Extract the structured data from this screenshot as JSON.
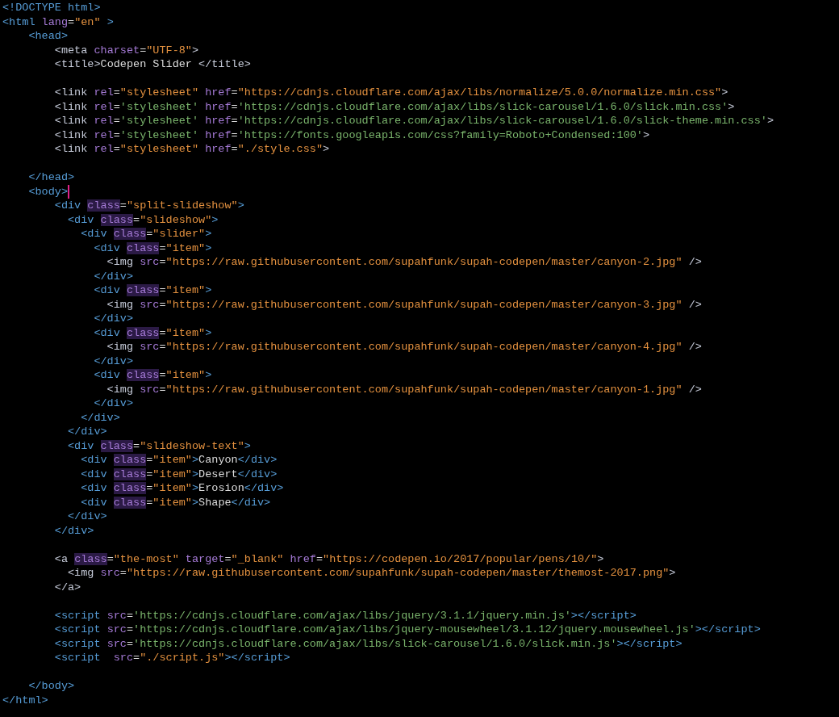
{
  "editor": {
    "lines": [
      {
        "kind": "code",
        "tokens": [
          {
            "kind": "tag",
            "text": "<!DOCTYPE html>"
          }
        ]
      },
      {
        "kind": "code",
        "tokens": [
          {
            "kind": "tag",
            "text": "<html"
          },
          {
            "kind": "attr",
            "text": " lang"
          },
          {
            "kind": "plain",
            "text": "="
          },
          {
            "kind": "string",
            "text": "\"en\""
          },
          {
            "kind": "tag",
            "text": " >"
          }
        ]
      },
      {
        "kind": "code",
        "tokens": [
          {
            "kind": "tag",
            "text": "    <head>"
          }
        ]
      },
      {
        "kind": "code",
        "tokens": [
          {
            "kind": "tag2",
            "text": "        <meta"
          },
          {
            "kind": "attr",
            "text": " charset"
          },
          {
            "kind": "plain",
            "text": "="
          },
          {
            "kind": "string",
            "text": "\"UTF-8\""
          },
          {
            "kind": "tag2",
            "text": ">"
          }
        ]
      },
      {
        "kind": "code",
        "tokens": [
          {
            "kind": "tag2",
            "text": "        <title>"
          },
          {
            "kind": "plain",
            "text": "Codepen Slider "
          },
          {
            "kind": "tag2",
            "text": "</title>"
          }
        ]
      },
      {
        "kind": "blank"
      },
      {
        "kind": "code",
        "tokens": [
          {
            "kind": "tag2",
            "text": "        <link"
          },
          {
            "kind": "attr",
            "text": " rel"
          },
          {
            "kind": "plain",
            "text": "="
          },
          {
            "kind": "string",
            "text": "\"stylesheet\""
          },
          {
            "kind": "attr",
            "text": " href"
          },
          {
            "kind": "plain",
            "text": "="
          },
          {
            "kind": "string",
            "text": "\"https://cdnjs.cloudflare.com/ajax/libs/normalize/5.0.0/normalize.min.css\""
          },
          {
            "kind": "tag2",
            "text": ">"
          }
        ]
      },
      {
        "kind": "code",
        "tokens": [
          {
            "kind": "tag2",
            "text": "        <link"
          },
          {
            "kind": "attr",
            "text": " rel"
          },
          {
            "kind": "plain",
            "text": "="
          },
          {
            "kind": "string-alt",
            "text": "'stylesheet'"
          },
          {
            "kind": "attr",
            "text": " href"
          },
          {
            "kind": "plain",
            "text": "="
          },
          {
            "kind": "string-alt",
            "text": "'https://cdnjs.cloudflare.com/ajax/libs/slick-carousel/1.6.0/slick.min.css'"
          },
          {
            "kind": "tag2",
            "text": ">"
          }
        ]
      },
      {
        "kind": "code",
        "tokens": [
          {
            "kind": "tag2",
            "text": "        <link"
          },
          {
            "kind": "attr",
            "text": " rel"
          },
          {
            "kind": "plain",
            "text": "="
          },
          {
            "kind": "string-alt",
            "text": "'stylesheet'"
          },
          {
            "kind": "attr",
            "text": " href"
          },
          {
            "kind": "plain",
            "text": "="
          },
          {
            "kind": "string-alt",
            "text": "'https://cdnjs.cloudflare.com/ajax/libs/slick-carousel/1.6.0/slick-theme.min.css'"
          },
          {
            "kind": "tag2",
            "text": ">"
          }
        ]
      },
      {
        "kind": "code",
        "tokens": [
          {
            "kind": "tag2",
            "text": "        <link"
          },
          {
            "kind": "attr",
            "text": " rel"
          },
          {
            "kind": "plain",
            "text": "="
          },
          {
            "kind": "string-alt",
            "text": "'stylesheet'"
          },
          {
            "kind": "attr",
            "text": " href"
          },
          {
            "kind": "plain",
            "text": "="
          },
          {
            "kind": "string-alt",
            "text": "'https://fonts.googleapis.com/css?family=Roboto+Condensed:100'"
          },
          {
            "kind": "tag2",
            "text": ">"
          }
        ]
      },
      {
        "kind": "code",
        "tokens": [
          {
            "kind": "tag2",
            "text": "        <link"
          },
          {
            "kind": "attr",
            "text": " rel"
          },
          {
            "kind": "plain",
            "text": "="
          },
          {
            "kind": "string",
            "text": "\"stylesheet\""
          },
          {
            "kind": "attr",
            "text": " href"
          },
          {
            "kind": "plain",
            "text": "="
          },
          {
            "kind": "string",
            "text": "\"./style.css\""
          },
          {
            "kind": "tag2",
            "text": ">"
          }
        ]
      },
      {
        "kind": "blank"
      },
      {
        "kind": "code",
        "tokens": [
          {
            "kind": "tag",
            "text": "    </head>"
          }
        ]
      },
      {
        "kind": "code",
        "tokens": [
          {
            "kind": "tag",
            "text": "    <body>"
          },
          {
            "kind": "cursor"
          }
        ]
      },
      {
        "kind": "code",
        "tokens": [
          {
            "kind": "tag",
            "text": "        <div "
          },
          {
            "kind": "attr-hl",
            "text": "class"
          },
          {
            "kind": "plain",
            "text": "="
          },
          {
            "kind": "string",
            "text": "\"split-slideshow\""
          },
          {
            "kind": "tag",
            "text": ">"
          }
        ]
      },
      {
        "kind": "code",
        "tokens": [
          {
            "kind": "tag",
            "text": "          <div "
          },
          {
            "kind": "attr-hl",
            "text": "class"
          },
          {
            "kind": "plain",
            "text": "="
          },
          {
            "kind": "string",
            "text": "\"slideshow\""
          },
          {
            "kind": "tag",
            "text": ">"
          }
        ]
      },
      {
        "kind": "code",
        "tokens": [
          {
            "kind": "tag",
            "text": "            <div "
          },
          {
            "kind": "attr-hl",
            "text": "class"
          },
          {
            "kind": "plain",
            "text": "="
          },
          {
            "kind": "string",
            "text": "\"slider\""
          },
          {
            "kind": "tag",
            "text": ">"
          }
        ]
      },
      {
        "kind": "code",
        "tokens": [
          {
            "kind": "tag",
            "text": "              <div "
          },
          {
            "kind": "attr-hl",
            "text": "class"
          },
          {
            "kind": "plain",
            "text": "="
          },
          {
            "kind": "string",
            "text": "\"item\""
          },
          {
            "kind": "tag",
            "text": ">"
          }
        ]
      },
      {
        "kind": "code",
        "tokens": [
          {
            "kind": "tag2",
            "text": "                <img"
          },
          {
            "kind": "attr",
            "text": " src"
          },
          {
            "kind": "plain",
            "text": "="
          },
          {
            "kind": "string",
            "text": "\"https://raw.githubusercontent.com/supahfunk/supah-codepen/master/canyon-2.jpg\""
          },
          {
            "kind": "tag2",
            "text": " />"
          }
        ]
      },
      {
        "kind": "code",
        "tokens": [
          {
            "kind": "tag",
            "text": "              </div>"
          }
        ]
      },
      {
        "kind": "code",
        "tokens": [
          {
            "kind": "tag",
            "text": "              <div "
          },
          {
            "kind": "attr-hl",
            "text": "class"
          },
          {
            "kind": "plain",
            "text": "="
          },
          {
            "kind": "string",
            "text": "\"item\""
          },
          {
            "kind": "tag",
            "text": ">"
          }
        ]
      },
      {
        "kind": "code",
        "tokens": [
          {
            "kind": "tag2",
            "text": "                <img"
          },
          {
            "kind": "attr",
            "text": " src"
          },
          {
            "kind": "plain",
            "text": "="
          },
          {
            "kind": "string",
            "text": "\"https://raw.githubusercontent.com/supahfunk/supah-codepen/master/canyon-3.jpg\""
          },
          {
            "kind": "tag2",
            "text": " />"
          }
        ]
      },
      {
        "kind": "code",
        "tokens": [
          {
            "kind": "tag",
            "text": "              </div>"
          }
        ]
      },
      {
        "kind": "code",
        "tokens": [
          {
            "kind": "tag",
            "text": "              <div "
          },
          {
            "kind": "attr-hl",
            "text": "class"
          },
          {
            "kind": "plain",
            "text": "="
          },
          {
            "kind": "string",
            "text": "\"item\""
          },
          {
            "kind": "tag",
            "text": ">"
          }
        ]
      },
      {
        "kind": "code",
        "tokens": [
          {
            "kind": "tag2",
            "text": "                <img"
          },
          {
            "kind": "attr",
            "text": " src"
          },
          {
            "kind": "plain",
            "text": "="
          },
          {
            "kind": "string",
            "text": "\"https://raw.githubusercontent.com/supahfunk/supah-codepen/master/canyon-4.jpg\""
          },
          {
            "kind": "tag2",
            "text": " />"
          }
        ]
      },
      {
        "kind": "code",
        "tokens": [
          {
            "kind": "tag",
            "text": "              </div>"
          }
        ]
      },
      {
        "kind": "code",
        "tokens": [
          {
            "kind": "tag",
            "text": "              <div "
          },
          {
            "kind": "attr-hl",
            "text": "class"
          },
          {
            "kind": "plain",
            "text": "="
          },
          {
            "kind": "string",
            "text": "\"item\""
          },
          {
            "kind": "tag",
            "text": ">"
          }
        ]
      },
      {
        "kind": "code",
        "tokens": [
          {
            "kind": "tag2",
            "text": "                <img"
          },
          {
            "kind": "attr",
            "text": " src"
          },
          {
            "kind": "plain",
            "text": "="
          },
          {
            "kind": "string",
            "text": "\"https://raw.githubusercontent.com/supahfunk/supah-codepen/master/canyon-1.jpg\""
          },
          {
            "kind": "tag2",
            "text": " />"
          }
        ]
      },
      {
        "kind": "code",
        "tokens": [
          {
            "kind": "tag",
            "text": "              </div>"
          }
        ]
      },
      {
        "kind": "code",
        "tokens": [
          {
            "kind": "tag",
            "text": "            </div>"
          }
        ]
      },
      {
        "kind": "code",
        "tokens": [
          {
            "kind": "tag",
            "text": "          </div>"
          }
        ]
      },
      {
        "kind": "code",
        "tokens": [
          {
            "kind": "tag",
            "text": "          <div "
          },
          {
            "kind": "attr-hl",
            "text": "class"
          },
          {
            "kind": "plain",
            "text": "="
          },
          {
            "kind": "string",
            "text": "\"slideshow-text\""
          },
          {
            "kind": "tag",
            "text": ">"
          }
        ]
      },
      {
        "kind": "code",
        "tokens": [
          {
            "kind": "tag",
            "text": "            <div "
          },
          {
            "kind": "attr-hl",
            "text": "class"
          },
          {
            "kind": "plain",
            "text": "="
          },
          {
            "kind": "string",
            "text": "\"item\""
          },
          {
            "kind": "tag",
            "text": ">"
          },
          {
            "kind": "plain",
            "text": "Canyon"
          },
          {
            "kind": "tag",
            "text": "</div>"
          }
        ]
      },
      {
        "kind": "code",
        "tokens": [
          {
            "kind": "tag",
            "text": "            <div "
          },
          {
            "kind": "attr-hl",
            "text": "class"
          },
          {
            "kind": "plain",
            "text": "="
          },
          {
            "kind": "string",
            "text": "\"item\""
          },
          {
            "kind": "tag",
            "text": ">"
          },
          {
            "kind": "plain",
            "text": "Desert"
          },
          {
            "kind": "tag",
            "text": "</div>"
          }
        ]
      },
      {
        "kind": "code",
        "tokens": [
          {
            "kind": "tag",
            "text": "            <div "
          },
          {
            "kind": "attr-hl",
            "text": "class"
          },
          {
            "kind": "plain",
            "text": "="
          },
          {
            "kind": "string",
            "text": "\"item\""
          },
          {
            "kind": "tag",
            "text": ">"
          },
          {
            "kind": "plain",
            "text": "Erosion"
          },
          {
            "kind": "tag",
            "text": "</div>"
          }
        ]
      },
      {
        "kind": "code",
        "tokens": [
          {
            "kind": "tag",
            "text": "            <div "
          },
          {
            "kind": "attr-hl",
            "text": "class"
          },
          {
            "kind": "plain",
            "text": "="
          },
          {
            "kind": "string",
            "text": "\"item\""
          },
          {
            "kind": "tag",
            "text": ">"
          },
          {
            "kind": "plain",
            "text": "Shape"
          },
          {
            "kind": "tag",
            "text": "</div>"
          }
        ]
      },
      {
        "kind": "code",
        "tokens": [
          {
            "kind": "tag",
            "text": "          </div>"
          }
        ]
      },
      {
        "kind": "code",
        "tokens": [
          {
            "kind": "tag",
            "text": "        </div>"
          }
        ]
      },
      {
        "kind": "blank"
      },
      {
        "kind": "code",
        "tokens": [
          {
            "kind": "tag2",
            "text": "        <a "
          },
          {
            "kind": "attr-hl",
            "text": "class"
          },
          {
            "kind": "plain",
            "text": "="
          },
          {
            "kind": "string",
            "text": "\"the-most\""
          },
          {
            "kind": "attr",
            "text": " target"
          },
          {
            "kind": "plain",
            "text": "="
          },
          {
            "kind": "string",
            "text": "\"_blank\""
          },
          {
            "kind": "attr",
            "text": " href"
          },
          {
            "kind": "plain",
            "text": "="
          },
          {
            "kind": "string",
            "text": "\"https://codepen.io/2017/popular/pens/10/\""
          },
          {
            "kind": "tag2",
            "text": ">"
          }
        ]
      },
      {
        "kind": "code",
        "tokens": [
          {
            "kind": "tag2",
            "text": "          <img"
          },
          {
            "kind": "attr",
            "text": " src"
          },
          {
            "kind": "plain",
            "text": "="
          },
          {
            "kind": "string",
            "text": "\"https://raw.githubusercontent.com/supahfunk/supah-codepen/master/themost-2017.png\""
          },
          {
            "kind": "tag2",
            "text": ">"
          }
        ]
      },
      {
        "kind": "code",
        "tokens": [
          {
            "kind": "tag2",
            "text": "        </a>"
          }
        ]
      },
      {
        "kind": "blank"
      },
      {
        "kind": "code",
        "tokens": [
          {
            "kind": "tag",
            "text": "        <script"
          },
          {
            "kind": "attr",
            "text": " src"
          },
          {
            "kind": "plain",
            "text": "="
          },
          {
            "kind": "string-alt",
            "text": "'https://cdnjs.cloudflare.com/ajax/libs/jquery/3.1.1/jquery.min.js'"
          },
          {
            "kind": "tag",
            "text": "></script>"
          }
        ]
      },
      {
        "kind": "code",
        "tokens": [
          {
            "kind": "tag",
            "text": "        <script"
          },
          {
            "kind": "attr",
            "text": " src"
          },
          {
            "kind": "plain",
            "text": "="
          },
          {
            "kind": "string-alt",
            "text": "'https://cdnjs.cloudflare.com/ajax/libs/jquery-mousewheel/3.1.12/jquery.mousewheel.js'"
          },
          {
            "kind": "tag",
            "text": "></script>"
          }
        ]
      },
      {
        "kind": "code",
        "tokens": [
          {
            "kind": "tag",
            "text": "        <script"
          },
          {
            "kind": "attr",
            "text": " src"
          },
          {
            "kind": "plain",
            "text": "="
          },
          {
            "kind": "string-alt",
            "text": "'https://cdnjs.cloudflare.com/ajax/libs/slick-carousel/1.6.0/slick.min.js'"
          },
          {
            "kind": "tag",
            "text": "></script>"
          }
        ]
      },
      {
        "kind": "code",
        "tokens": [
          {
            "kind": "tag",
            "text": "        <script"
          },
          {
            "kind": "attr",
            "text": "  src"
          },
          {
            "kind": "plain",
            "text": "="
          },
          {
            "kind": "string",
            "text": "\"./script.js\""
          },
          {
            "kind": "tag",
            "text": "></script>"
          }
        ]
      },
      {
        "kind": "blank"
      },
      {
        "kind": "code",
        "tokens": [
          {
            "kind": "tag",
            "text": "    </body>"
          }
        ]
      },
      {
        "kind": "code",
        "tokens": [
          {
            "kind": "tag",
            "text": "</html>"
          }
        ]
      }
    ]
  }
}
